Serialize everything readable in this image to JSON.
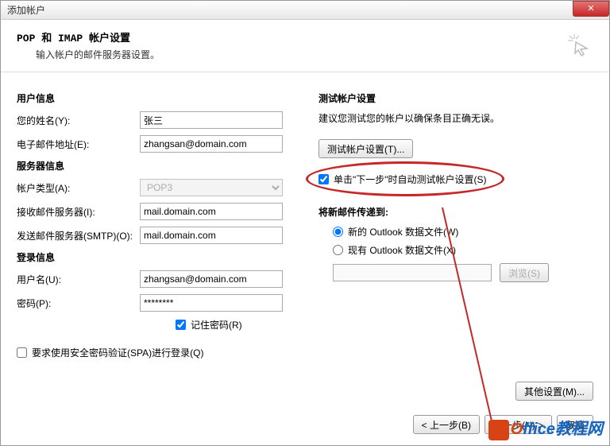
{
  "window": {
    "title": "添加帐户"
  },
  "header": {
    "title": "POP 和 IMAP 帐户设置",
    "subtitle": "输入帐户的邮件服务器设置。"
  },
  "left": {
    "userinfo_title": "用户信息",
    "name_label": "您的姓名(Y):",
    "name_value": "张三",
    "email_label": "电子邮件地址(E):",
    "email_value": "zhangsan@domain.com",
    "server_title": "服务器信息",
    "acct_type_label": "帐户类型(A):",
    "acct_type_value": "POP3",
    "incoming_label": "接收邮件服务器(I):",
    "incoming_value": "mail.domain.com",
    "outgoing_label": "发送邮件服务器(SMTP)(O):",
    "outgoing_value": "mail.domain.com",
    "login_title": "登录信息",
    "user_label": "用户名(U):",
    "user_value": "zhangsan@domain.com",
    "pwd_label": "密码(P):",
    "pwd_value": "********",
    "remember_pwd": "记住密码(R)",
    "spa_label": "要求使用安全密码验证(SPA)进行登录(Q)"
  },
  "right": {
    "test_title": "测试帐户设置",
    "test_note": "建议您测试您的帐户以确保条目正确无误。",
    "test_btn": "测试帐户设置(T)...",
    "auto_test": "单击\"下一步\"时自动测试帐户设置(S)",
    "deliver_title": "将新邮件传递到:",
    "new_file": "新的 Outlook 数据文件(W)",
    "exist_file": "现有 Outlook 数据文件(X)",
    "browse_btn": "浏览(S)",
    "more_btn": "其他设置(M)..."
  },
  "footer": {
    "back": "< 上一步(B)",
    "next": "下一步(N) >",
    "cancel": "取消"
  },
  "watermark": {
    "o": "O",
    "rest": "ffice教程网"
  }
}
